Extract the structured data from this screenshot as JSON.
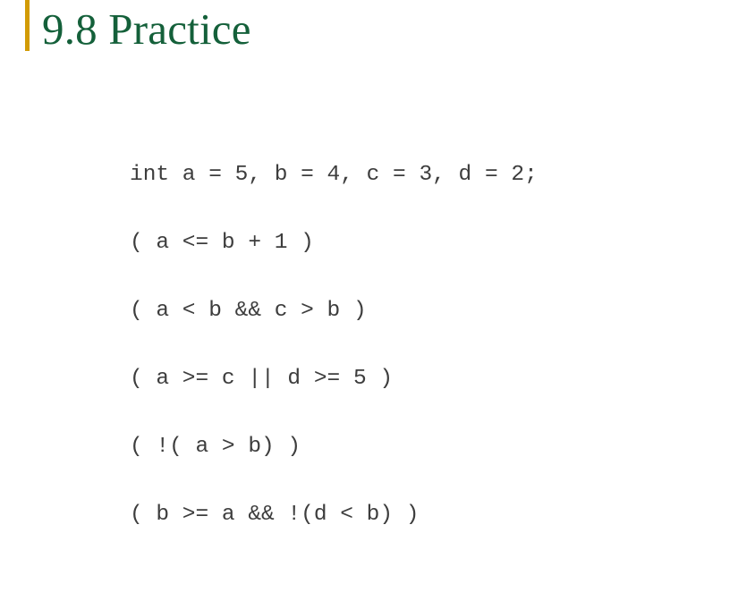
{
  "slide": {
    "title": "9.8 Practice",
    "accent_color": "#d29b05",
    "title_color": "#14603a",
    "background_color": "#ffffff",
    "code_color": "#3d3d3d"
  },
  "code": {
    "lines": [
      "int a = 5, b = 4, c = 3, d = 2;",
      "( a <= b + 1 )",
      "( a < b && c > b )",
      "( a >= c || d >= 5 )",
      "( !( a > b) )",
      "( b >= a && !(d < b) )"
    ]
  }
}
